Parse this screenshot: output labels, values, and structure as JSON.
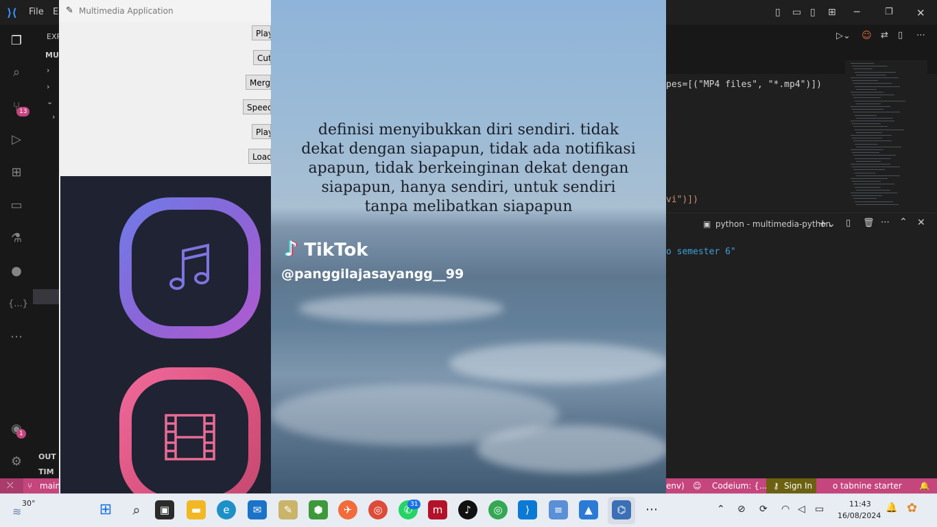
{
  "vscode": {
    "menu": [
      "File",
      "E"
    ],
    "sidebar_header": "EXP",
    "sidebar_items": [
      "MU",
      "OUT",
      "TIM"
    ],
    "source_control_badge": "13",
    "accounts_badge": "1",
    "ext_icon_text": "{...}",
    "code_line_1": "pes=[(\"MP4 files\", \"*.mp4\")])",
    "code_line_2": "vi\")])",
    "terminal_title": "python - multimedia-python",
    "terminal_line": "o semester 6\"",
    "status": {
      "branch": "main",
      "env": "env)",
      "codeium": "Codeium: {...}",
      "sign_in": "Sign In",
      "tabnine": "o tabnine starter"
    }
  },
  "tk": {
    "title": "Multimedia Application",
    "buttons": [
      "Play",
      "Cut",
      "Merge",
      "Speed",
      "Play",
      "Load"
    ]
  },
  "video": {
    "caption": "definisi menyibukkan diri sendiri. tidak dekat dengan siapapun, tidak ada notifikasi apapun, tidak berkeinginan dekat dengan siapapun, hanya sendiri, untuk sendiri tanpa melibatkan siapapun",
    "logo": "TikTok",
    "handle": "@panggilajasayangg__99"
  },
  "taskbar": {
    "weather": "30°",
    "whatsapp_badge": "31",
    "time": "11:43",
    "date": "16/08/2024"
  },
  "colors": {
    "accent_pink": "#c5457d",
    "vscode_bg": "#1e1e1e",
    "tk_bg": "#f0f0f0"
  }
}
